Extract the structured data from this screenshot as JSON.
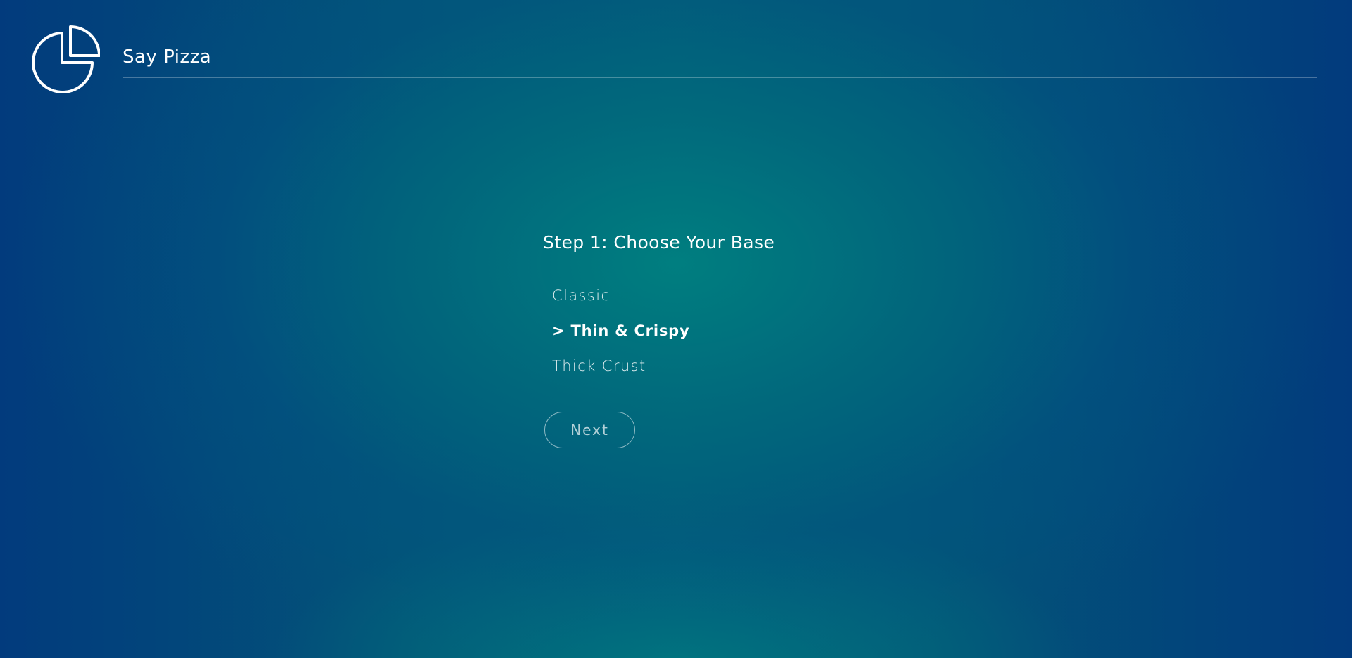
{
  "app": {
    "title": "Say Pizza",
    "logo_icon": "pie-chart-icon"
  },
  "step": {
    "title": "Step 1: Choose Your Base",
    "options": [
      {
        "label": "Classic",
        "selected": false
      },
      {
        "label": "> Thin & Crispy",
        "selected": true
      },
      {
        "label": "Thick Crust",
        "selected": false
      }
    ],
    "next_label": "Next"
  },
  "colors": {
    "background_center": "#008080",
    "background_edge": "#023b7d",
    "text": "#ffffff"
  }
}
